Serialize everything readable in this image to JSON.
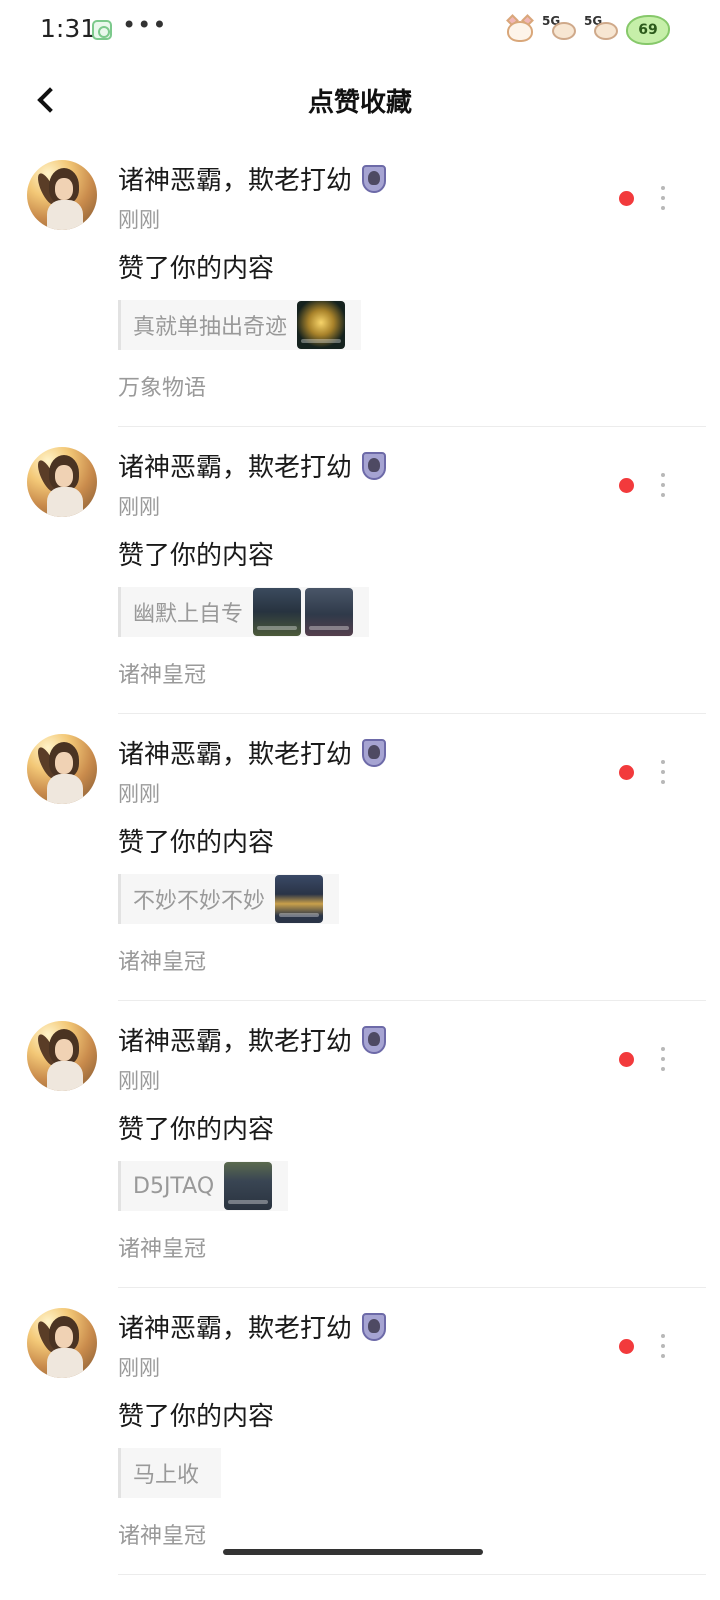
{
  "status_bar": {
    "time": "1:31",
    "app_icon": "messaging-app-icon",
    "more": "•••",
    "signal_1_label": "5G",
    "signal_2_label": "5G",
    "battery_level": "69"
  },
  "header": {
    "title": "点赞收藏",
    "back_icon": "chevron-left-icon"
  },
  "notifications": [
    {
      "username": "诸神恶霸，欺老打幼",
      "time": "刚刚",
      "action": "赞了你的内容",
      "quote": "真就单抽出奇迹",
      "thumbnails": [
        "gold"
      ],
      "group": "万象物语",
      "unread": true
    },
    {
      "username": "诸神恶霸，欺老打幼",
      "time": "刚刚",
      "action": "赞了你的内容",
      "quote": "幽默上自专",
      "thumbnails": [
        "game1",
        "game2"
      ],
      "group": "诸神皇冠",
      "unread": true
    },
    {
      "username": "诸神恶霸，欺老打幼",
      "time": "刚刚",
      "action": "赞了你的内容",
      "quote": "不妙不妙不妙",
      "thumbnails": [
        "bowl"
      ],
      "group": "诸神皇冠",
      "unread": true
    },
    {
      "username": "诸神恶霸，欺老打幼",
      "time": "刚刚",
      "action": "赞了你的内容",
      "quote": "D5JTAQ",
      "thumbnails": [
        "map"
      ],
      "group": "诸神皇冠",
      "unread": true
    },
    {
      "username": "诸神恶霸，欺老打幼",
      "time": "刚刚",
      "action": "赞了你的内容",
      "quote": "马上收",
      "thumbnails": [],
      "group": "诸神皇冠",
      "unread": true
    }
  ],
  "colors": {
    "unread_dot": "#f23a3c",
    "secondary_text": "#9a9a9a",
    "primary_text": "#1a1a1a"
  }
}
